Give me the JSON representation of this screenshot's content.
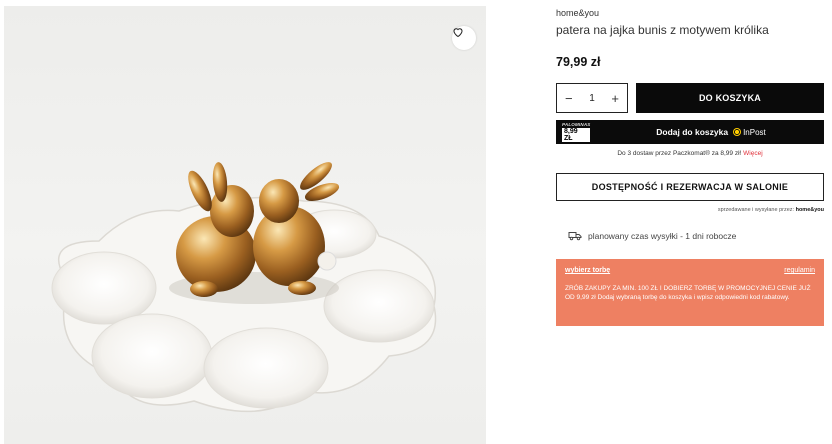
{
  "product": {
    "brand": "home&you",
    "title": "patera na jajka bunis z motywem królika",
    "price": "79,99 zł",
    "image_alt": "white ceramic egg plate with two gold bunny figurines"
  },
  "purchase": {
    "quantity": "1",
    "minus": "−",
    "plus": "+",
    "add_to_cart_label": "DO KOSZYKA"
  },
  "inpost": {
    "badge_small": "PALOMINAS",
    "badge_price": "8,99 ZŁ",
    "label": "Dodaj do koszyka",
    "logo_text": "InPost",
    "note": "Do 3 dostaw przez Paczkomat® za 8,99 zł!",
    "more_link": "Więcej"
  },
  "store": {
    "availability_label": "DOSTĘPNOŚĆ I REZERWACJA W SALONIE",
    "seller_prefix": "sprzedawane i wysyłane przez:",
    "seller_name": "home&you"
  },
  "delivery": {
    "text": "planowany czas wysyłki - 1 dni robocze"
  },
  "promo": {
    "link": "wybierz torbę",
    "rules": "regulamin",
    "text": "ZRÓB ZAKUPY ZA MIN. 100 ZŁ I DOBIERZ TORBĘ W PROMOCYJNEJ CENIE JUŻ OD 9,99 zł Dodaj wybraną torbę do koszyka i wpisz odpowiedni kod rabatowy.",
    "background": "#ee8062"
  },
  "icons": {
    "wishlist": "heart-icon",
    "delivery": "truck-icon"
  }
}
